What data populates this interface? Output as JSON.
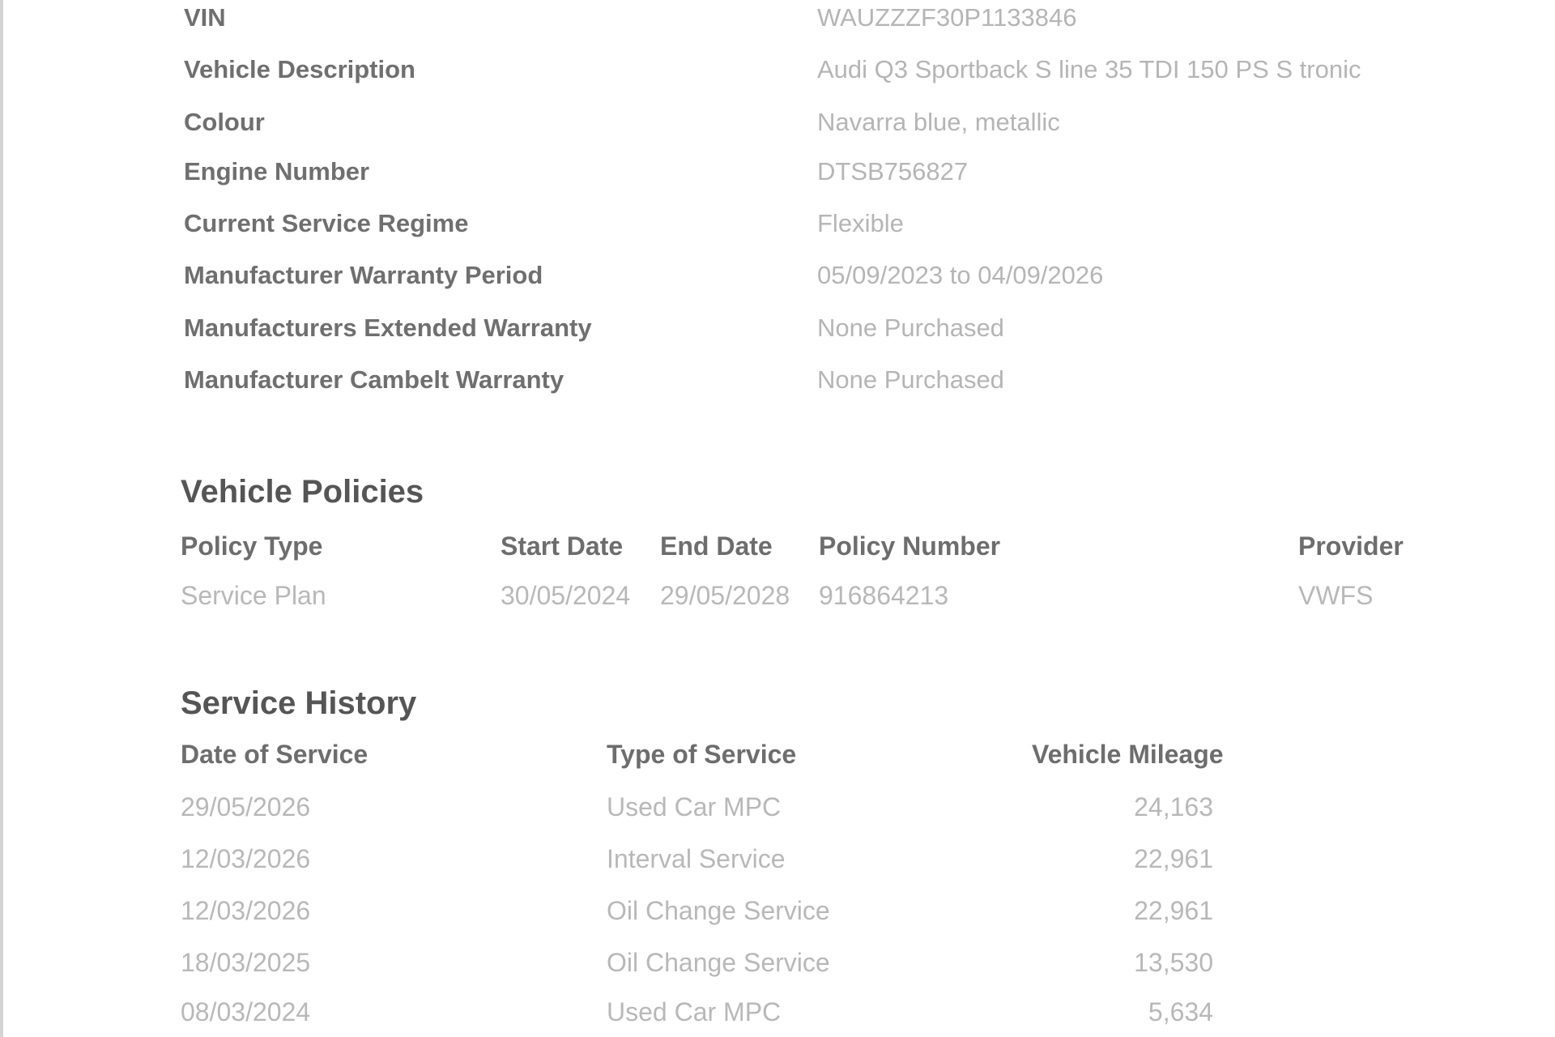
{
  "vehicle_details": [
    {
      "label": "VIN",
      "value": "WAUZZZF30P1133846"
    },
    {
      "label": "Vehicle Description",
      "value": "Audi Q3 Sportback S line 35 TDI  150 PS S tronic"
    },
    {
      "label": "Colour",
      "value": "Navarra blue, metallic"
    },
    {
      "label": "Engine Number",
      "value": "DTSB756827"
    },
    {
      "label": "Current Service Regime",
      "value": "Flexible"
    },
    {
      "label": "Manufacturer Warranty Period",
      "value": "05/09/2023 to 04/09/2026"
    },
    {
      "label": "Manufacturers Extended Warranty",
      "value": "None Purchased"
    },
    {
      "label": "Manufacturer Cambelt Warranty",
      "value": "None Purchased"
    }
  ],
  "vehicle_policies": {
    "heading": "Vehicle Policies",
    "columns": {
      "policy_type": "Policy Type",
      "start_date": "Start Date",
      "end_date": "End Date",
      "policy_number": "Policy Number",
      "provider": "Provider"
    },
    "rows": [
      {
        "policy_type": "Service Plan",
        "start_date": "30/05/2024",
        "end_date": "29/05/2028",
        "policy_number": "916864213",
        "provider": "VWFS"
      }
    ]
  },
  "service_history": {
    "heading": "Service History",
    "columns": {
      "date": "Date of Service",
      "type": "Type of Service",
      "mileage": "Vehicle Mileage"
    },
    "rows": [
      {
        "date": "29/05/2026",
        "type": "Used Car MPC",
        "mileage": "24,163"
      },
      {
        "date": "12/03/2026",
        "type": "Interval Service",
        "mileage": "22,961"
      },
      {
        "date": "12/03/2026",
        "type": "Oil Change Service",
        "mileage": "22,961"
      },
      {
        "date": "18/03/2025",
        "type": "Oil Change Service",
        "mileage": "13,530"
      },
      {
        "date": "08/03/2024",
        "type": "Used Car MPC",
        "mileage": "5,634"
      }
    ]
  }
}
